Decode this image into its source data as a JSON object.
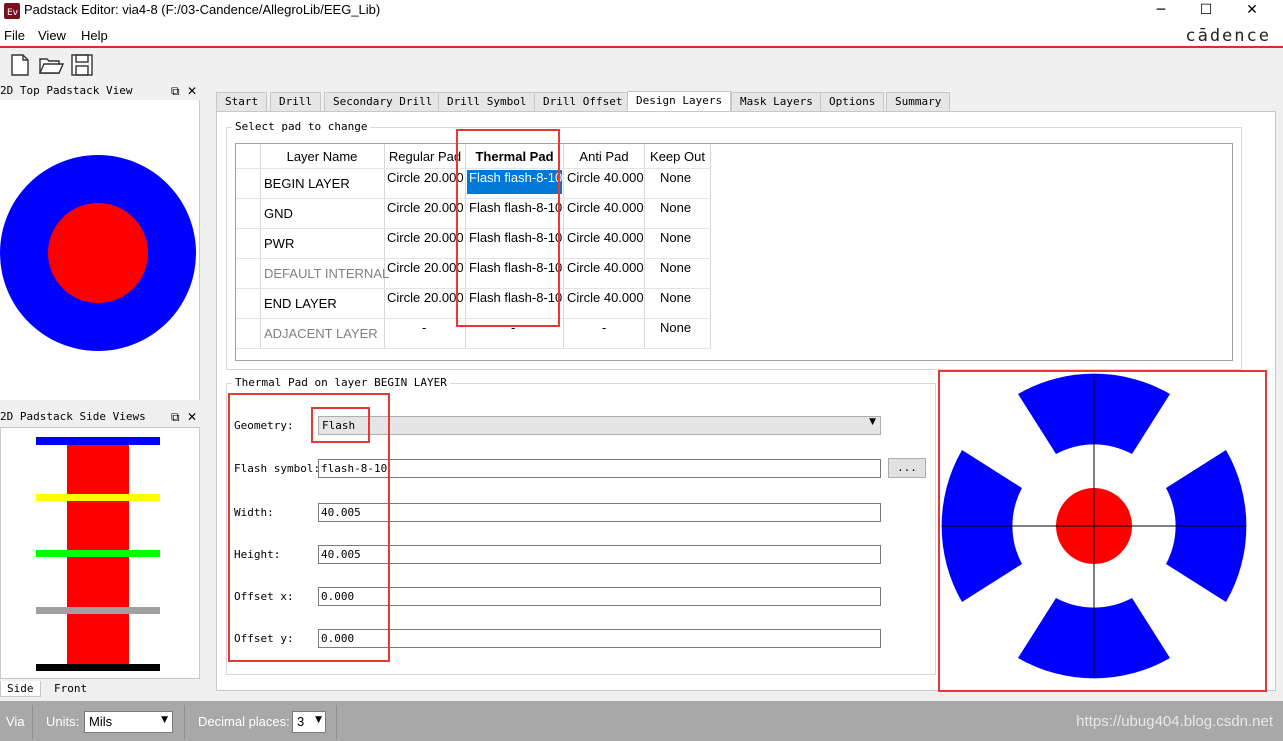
{
  "window": {
    "title": "Padstack Editor: via4-8  (F:/03-Candence/AllegroLib/EEG_Lib)",
    "controls": {
      "minimize": "─",
      "maximize": "☐",
      "close": "✕"
    }
  },
  "menu": {
    "items": [
      "File",
      "View",
      "Help"
    ],
    "brand": "cādence"
  },
  "toolbar": {
    "icons": [
      "new-file-icon",
      "open-folder-icon",
      "save-icon"
    ]
  },
  "top_view": {
    "title": "2D Top Padstack View",
    "outer_color": "#0000ff",
    "inner_color": "#ff0000"
  },
  "side_view": {
    "title": "2D Padstack Side Views",
    "tabs": [
      "Side",
      "Front"
    ],
    "layer_colors": [
      "#0000ff",
      "#ffff00",
      "#00ff00",
      "#a0a0a0",
      "#000000"
    ],
    "barrel_color": "#ff0000"
  },
  "tabs": [
    "Start",
    "Drill",
    "Secondary Drill",
    "Drill Symbol",
    "Drill Offset",
    "Design Layers",
    "Mask Layers",
    "Options",
    "Summary"
  ],
  "active_tab": "Design Layers",
  "layer_group": {
    "title": "Select pad to change",
    "columns": [
      "Layer Name",
      "Regular Pad",
      "Thermal Pad",
      "Anti Pad",
      "Keep Out"
    ],
    "rows": [
      {
        "layer": "BEGIN LAYER",
        "regular": "Circle 20.000",
        "thermal": "Flash flash-8-10",
        "anti": "Circle 40.000",
        "keepout": "None"
      },
      {
        "layer": "GND",
        "regular": "Circle 20.000",
        "thermal": "Flash flash-8-10",
        "anti": "Circle 40.000",
        "keepout": "None"
      },
      {
        "layer": "PWR",
        "regular": "Circle 20.000",
        "thermal": "Flash flash-8-10",
        "anti": "Circle 40.000",
        "keepout": "None"
      },
      {
        "layer": "DEFAULT INTERNAL",
        "regular": "Circle 20.000",
        "thermal": "Flash flash-8-10",
        "anti": "Circle 40.000",
        "keepout": "None"
      },
      {
        "layer": "END LAYER",
        "regular": "Circle 20.000",
        "thermal": "Flash flash-8-10",
        "anti": "Circle 40.000",
        "keepout": "None"
      },
      {
        "layer": "ADJACENT LAYER",
        "regular": "-",
        "thermal": "-",
        "anti": "-",
        "keepout": "None"
      }
    ]
  },
  "thermal_group": {
    "title": "Thermal Pad on layer BEGIN LAYER",
    "geometry_label": "Geometry:",
    "geometry_value": "Flash",
    "flash_label": "Flash symbol:",
    "flash_value": "flash-8-10",
    "browse_label": "...",
    "width_label": "Width:",
    "width_value": "40.005",
    "height_label": "Height:",
    "height_value": "40.005",
    "offset_x_label": "Offset x:",
    "offset_x_value": "0.000",
    "offset_y_label": "Offset y:",
    "offset_y_value": "0.000"
  },
  "preview": {
    "pad_color": "#0000ff",
    "drill_color": "#ff0000"
  },
  "status": {
    "mode": "Via",
    "units_label": "Units:",
    "units_value": "Mils",
    "decimal_label": "Decimal places:",
    "decimal_value": "3",
    "watermark": "https://ubug404.blog.csdn.net"
  },
  "highlight_color": "#e53935"
}
